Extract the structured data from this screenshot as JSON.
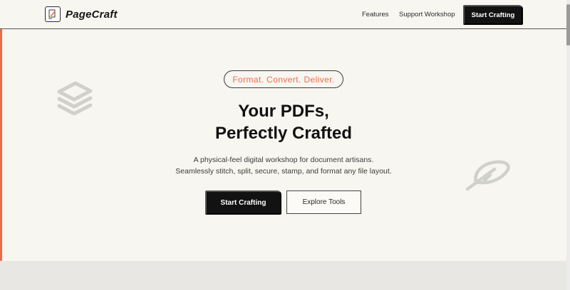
{
  "header": {
    "brand_name": "PageCraft",
    "nav": [
      {
        "label": "Features"
      },
      {
        "label": "Support Workshop"
      }
    ],
    "cta_label": "Start Crafting"
  },
  "hero": {
    "tagline": "Format. Convert. Deliver.",
    "headline_line1": "Your PDFs,",
    "headline_line2": "Perfectly Crafted",
    "subtitle_line1": "A physical-feel digital workshop for document artisans.",
    "subtitle_line2": "Seamlessly stitch, split, secure, stamp, and format any file layout.",
    "primary_button": "Start Crafting",
    "secondary_button": "Explore Tools"
  },
  "icons": {
    "logo": "pagecraft-logo-icon",
    "left_decoration": "stacked-layers-icon",
    "right_decoration": "feather-icon"
  },
  "colors": {
    "accent": "#ee6b4d",
    "dark_button": "#121212",
    "background": "#f8f6f1"
  }
}
